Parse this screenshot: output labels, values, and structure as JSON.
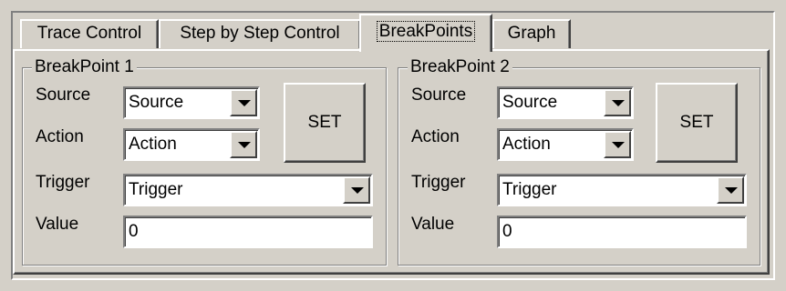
{
  "tabs": [
    {
      "label": "Trace Control"
    },
    {
      "label": "Step by Step Control"
    },
    {
      "label": "BreakPoints",
      "active": true
    },
    {
      "label": "Graph"
    }
  ],
  "breakpoints": [
    {
      "title": "BreakPoint 1",
      "source_label": "Source",
      "source_value": "Source",
      "action_label": "Action",
      "action_value": "Action",
      "trigger_label": "Trigger",
      "trigger_value": "Trigger",
      "value_label": "Value",
      "value_value": "0",
      "set_label": "SET"
    },
    {
      "title": "BreakPoint  2",
      "source_label": "Source",
      "source_value": "Source",
      "action_label": "Action",
      "action_value": "Action",
      "trigger_label": "Trigger",
      "trigger_value": "Trigger",
      "value_label": "Value",
      "value_value": "0",
      "set_label": "SET"
    }
  ]
}
